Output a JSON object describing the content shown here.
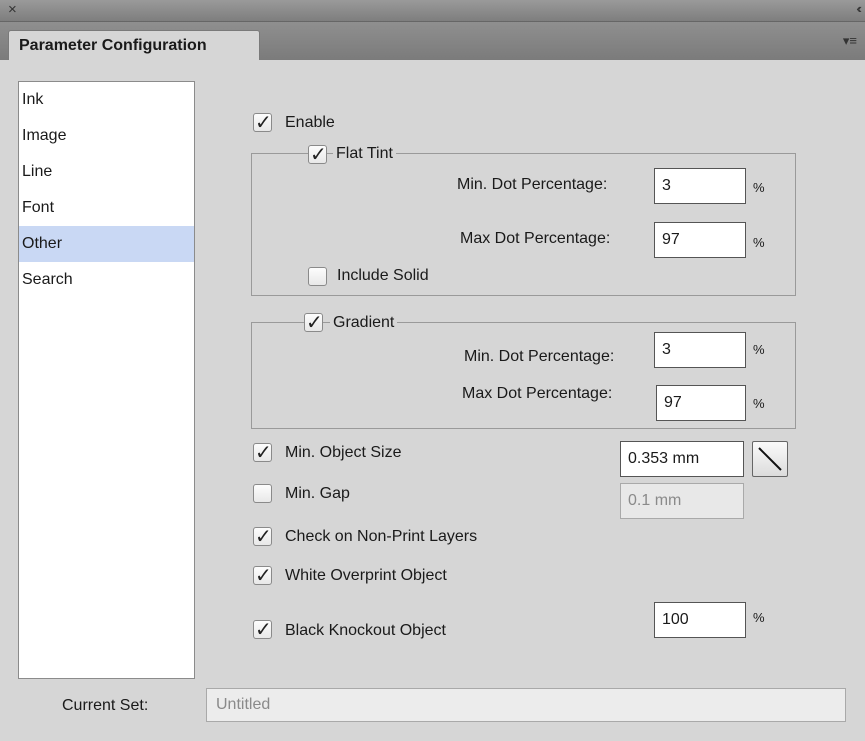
{
  "window": {
    "close_glyph": "×",
    "collapse_glyph": "‹‹",
    "tab_title": "Parameter Configuration",
    "menu_glyph": "▾≡"
  },
  "sidebar": {
    "items": [
      {
        "label": "Ink",
        "selected": false
      },
      {
        "label": "Image",
        "selected": false
      },
      {
        "label": "Line",
        "selected": false
      },
      {
        "label": "Font",
        "selected": false
      },
      {
        "label": "Other",
        "selected": true
      },
      {
        "label": "Search",
        "selected": false
      }
    ]
  },
  "options": {
    "check_glyph": "✓",
    "enable": {
      "label": "Enable",
      "checked": true
    },
    "flat_tint": {
      "label": "Flat Tint",
      "checked": true,
      "min_label": "Min. Dot Percentage:",
      "min_value": "3",
      "max_label": "Max Dot Percentage:",
      "max_value": "97",
      "unit": "%",
      "include_solid": {
        "label": "Include Solid",
        "checked": false
      }
    },
    "gradient": {
      "label": "Gradient",
      "checked": true,
      "min_label": "Min. Dot Percentage:",
      "min_value": "3",
      "max_label": "Max Dot Percentage:",
      "max_value": "97",
      "unit": "%"
    },
    "min_object_size": {
      "label": "Min. Object Size",
      "checked": true,
      "value": "0.353 mm",
      "button_icon": "diagonal-line-icon"
    },
    "min_gap": {
      "label": "Min. Gap",
      "checked": false,
      "value": "0.1 mm"
    },
    "check_non_print": {
      "label": "Check on Non-Print Layers",
      "checked": true
    },
    "white_overprint": {
      "label": "White Overprint Object",
      "checked": true
    },
    "black_knockout": {
      "label": "Black Knockout Object",
      "checked": true,
      "value": "100",
      "unit": "%"
    }
  },
  "footer": {
    "current_set_label": "Current Set:",
    "current_set_value": "Untitled"
  },
  "colors": {
    "selection": "#c9d8f4",
    "panel_bg": "#d6d6d6",
    "header_bg": "#8a8a8a"
  }
}
